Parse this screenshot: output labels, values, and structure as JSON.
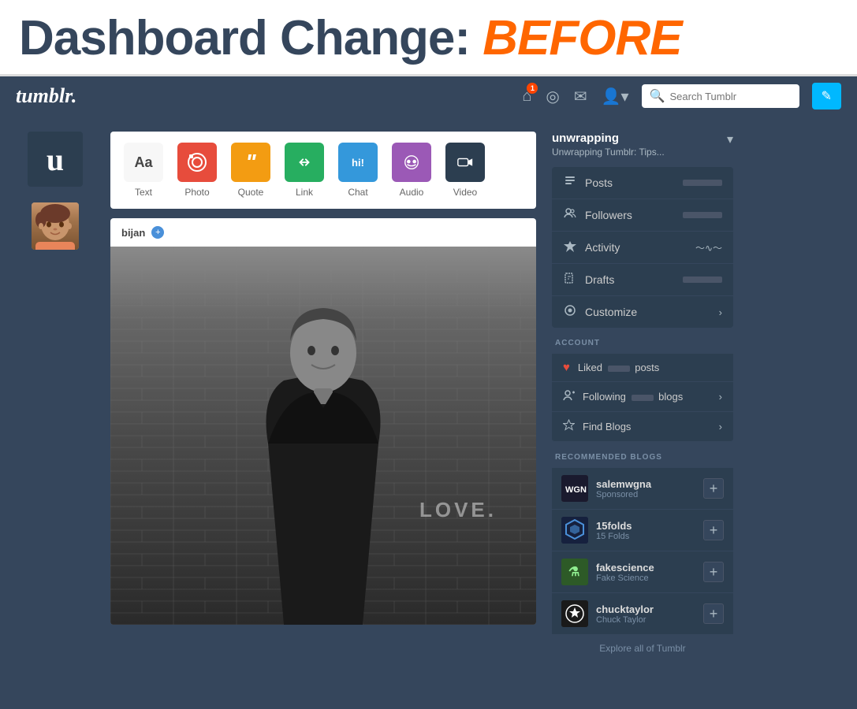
{
  "banner": {
    "title_main": "Dashboard Change:",
    "title_highlight": "BEFORE"
  },
  "navbar": {
    "logo": "tumblr.",
    "search_placeholder": "Search Tumblr",
    "home_badge": "1",
    "edit_icon": "✎"
  },
  "post_types": [
    {
      "id": "text",
      "label": "Text",
      "icon": "Aa",
      "style": "text"
    },
    {
      "id": "photo",
      "label": "Photo",
      "icon": "📷",
      "style": "photo"
    },
    {
      "id": "quote",
      "label": "Quote",
      "icon": "❝❞",
      "style": "quote"
    },
    {
      "id": "link",
      "label": "Link",
      "icon": "🔗",
      "style": "link"
    },
    {
      "id": "chat",
      "label": "Chat",
      "icon": "hi!",
      "style": "chat"
    },
    {
      "id": "audio",
      "label": "Audio",
      "icon": "🎧",
      "style": "audio"
    },
    {
      "id": "video",
      "label": "Video",
      "icon": "🎬",
      "style": "video"
    }
  ],
  "post": {
    "user": "bijan",
    "love_text": "LOVE."
  },
  "sidebar": {
    "blog_name": "unwrapping",
    "blog_sub": "Unwrapping Tumblr: Tips...",
    "nav_items": [
      {
        "id": "posts",
        "label": "Posts",
        "icon": "📄",
        "has_bar": true
      },
      {
        "id": "followers",
        "label": "Followers",
        "icon": "👥",
        "has_bar": true
      },
      {
        "id": "activity",
        "label": "Activity",
        "icon": "⚡",
        "has_wave": true
      },
      {
        "id": "drafts",
        "label": "Drafts",
        "icon": "✏️",
        "has_bar": true
      },
      {
        "id": "customize",
        "label": "Customize",
        "icon": "👁",
        "has_chevron": true
      }
    ],
    "account_label": "ACCOUNT",
    "account_items": [
      {
        "id": "liked",
        "label_pre": "Liked",
        "label_post": "posts",
        "icon": "♥",
        "icon_style": "heart",
        "has_chevron": false
      },
      {
        "id": "following",
        "label_pre": "Following",
        "label_post": "blogs",
        "icon": "👤",
        "icon_style": "person",
        "has_chevron": true
      },
      {
        "id": "find-blogs",
        "label": "Find Blogs",
        "icon": "✦",
        "icon_style": "star",
        "has_chevron": true
      }
    ],
    "recommended_label": "RECOMMENDED BLOGS",
    "recommended_blogs": [
      {
        "id": "salemwgna",
        "name": "salemwgna",
        "sub": "Sponsored",
        "avatar_style": "salem"
      },
      {
        "id": "15folds",
        "name": "15folds",
        "sub": "15 Folds",
        "avatar_style": "15folds"
      },
      {
        "id": "fakescience",
        "name": "fakescience",
        "sub": "Fake Science",
        "avatar_style": "fakescience"
      },
      {
        "id": "chucktaylor",
        "name": "chucktaylor",
        "sub": "Chuck Taylor",
        "avatar_style": "chuck"
      }
    ],
    "explore_link": "Explore all of Tumblr"
  }
}
